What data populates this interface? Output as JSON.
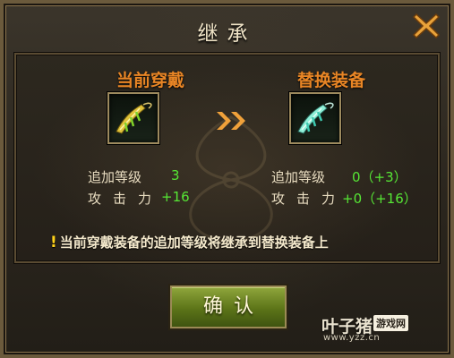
{
  "dialog": {
    "title": "继承",
    "close_icon": "close-x-icon",
    "accent_color": "#e88525",
    "value_color": "#56e635"
  },
  "current": {
    "heading": "当前穿戴",
    "item_icon": "gold-bow-icon",
    "stats": [
      {
        "label": "追加等级",
        "value": "3"
      },
      {
        "label": "攻击力",
        "value": "+16"
      }
    ]
  },
  "replacement": {
    "heading": "替换装备",
    "item_icon": "teal-bow-icon",
    "stats": [
      {
        "label": "追加等级",
        "value": "0（+3）"
      },
      {
        "label": "攻击力",
        "value": "+0（+16）"
      }
    ]
  },
  "arrow_icon": "double-chevron-right-icon",
  "notice": {
    "icon": "exclamation-icon",
    "text": "当前穿戴装备的追加等级将继承到替换装备上"
  },
  "confirm_button": "确认",
  "watermark": {
    "logo": "叶子猪",
    "tag": "游戏网",
    "url": "www.yzz.cn"
  }
}
